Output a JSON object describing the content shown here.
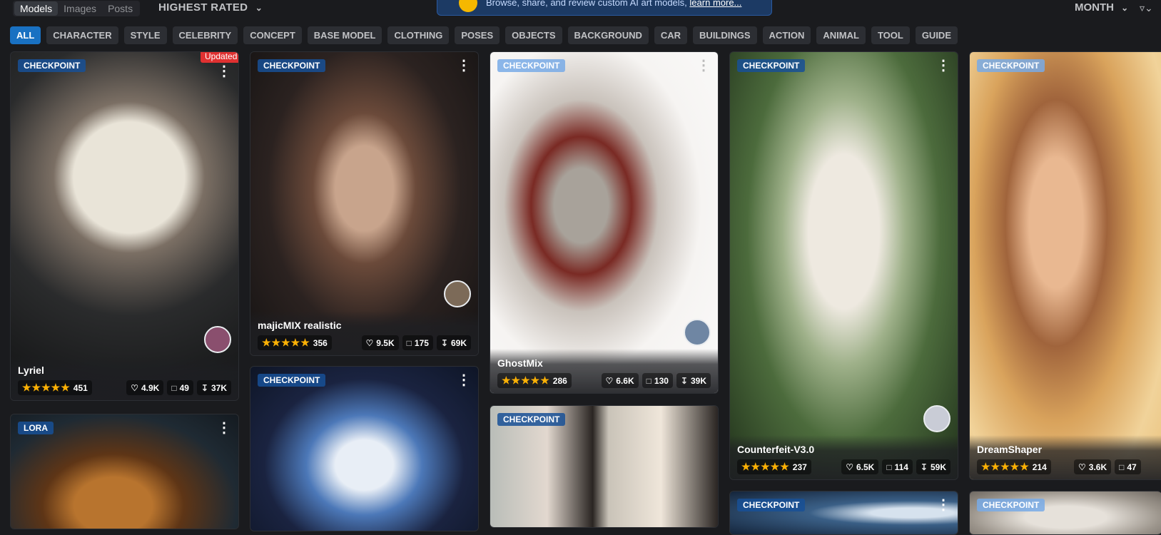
{
  "tabs": [
    "Models",
    "Images",
    "Posts"
  ],
  "sort_label": "HIGHEST RATED",
  "banner_text": "Browse, share, and review custom AI art models,",
  "banner_link": "learn more...",
  "period_label": "MONTH",
  "categories": [
    "ALL",
    "CHARACTER",
    "STYLE",
    "CELEBRITY",
    "CONCEPT",
    "BASE MODEL",
    "CLOTHING",
    "POSES",
    "OBJECTS",
    "BACKGROUND",
    "CAR",
    "BUILDINGS",
    "ACTION",
    "ANIMAL",
    "TOOL",
    "GUIDE"
  ],
  "active_category": "ALL",
  "cards": [
    {
      "type": "CHECKPOINT",
      "updated_label": "Updated",
      "name": "Lyriel",
      "rating": "451",
      "likes": "4.9K",
      "comments": "49",
      "downloads": "37K"
    },
    {
      "type": "CHECKPOINT",
      "name": "majicMIX realistic",
      "rating": "356",
      "likes": "9.5K",
      "comments": "175",
      "downloads": "69K"
    },
    {
      "type": "CHECKPOINT",
      "name": "GhostMix",
      "rating": "286",
      "likes": "6.6K",
      "comments": "130",
      "downloads": "39K"
    },
    {
      "type": "CHECKPOINT",
      "name": "Counterfeit-V3.0",
      "rating": "237",
      "likes": "6.5K",
      "comments": "114",
      "downloads": "59K"
    },
    {
      "type": "CHECKPOINT",
      "name": "DreamShaper",
      "rating": "214",
      "likes": "3.6K",
      "comments": "47",
      "downloads": ""
    },
    {
      "type": "LORA"
    },
    {
      "type": "CHECKPOINT"
    },
    {
      "type": "CHECKPOINT"
    },
    {
      "type": "CHECKPOINT"
    },
    {
      "type": "CHECKPOINT"
    }
  ],
  "colors": {
    "background": "#1a1b1e",
    "accent": "#1971c2",
    "star": "#fab005",
    "updated": "#e03131"
  }
}
